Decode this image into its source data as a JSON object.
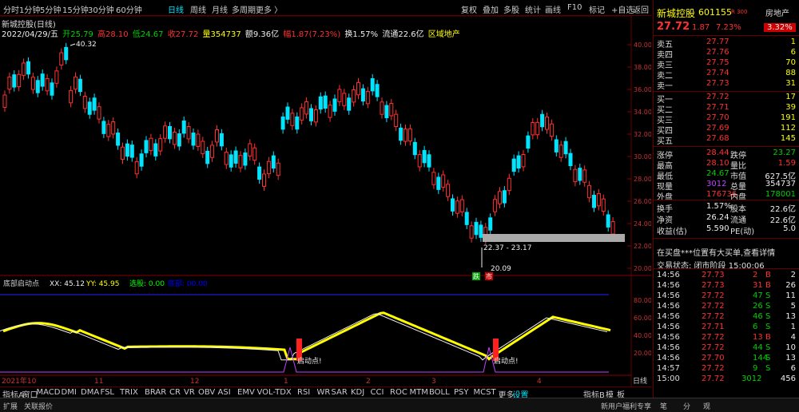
{
  "toolbar": {
    "periods": [
      "分时",
      "1分钟",
      "5分钟",
      "15分钟",
      "30分钟",
      "60分钟",
      "日线",
      "周线",
      "月线",
      "多周期",
      "更多 〉"
    ],
    "active": "日线",
    "actions": [
      "复权",
      "叠加",
      "多股",
      "统计",
      "画线",
      "F10",
      "标记",
      "+自选",
      "返回"
    ]
  },
  "info": {
    "title": "新城控股(日线)",
    "date": "2022/04/29/五",
    "open": "开25.79",
    "high": "高28.10",
    "low": "低24.67",
    "close": "收27.72",
    "volume": "量354737",
    "amount": "额9.36亿",
    "change": "幅1.87(7.23%)",
    "turnover": "换1.57%",
    "circulation": "流通22.6亿",
    "sector": "区域地产"
  },
  "price_axis": [
    "40.00",
    "38.00",
    "36.00",
    "34.00",
    "32.00",
    "30.00",
    "28.00",
    "26.00",
    "24.00",
    "22.00",
    "20.00"
  ],
  "annotations": {
    "high": "40.32",
    "low": "20.09",
    "band": "22.37 - 23.17",
    "tag1": "跌",
    "tag2": "市"
  },
  "indicator": {
    "name": "底部启动点",
    "xx": "XX: 45.12",
    "yy": "YY: 45.95",
    "sel": "选股: 0.00",
    "extra": "底部: 00.00",
    "axis": [
      "80.00",
      "60.00",
      "40.00",
      "20.00"
    ],
    "signal_label": "启动点!"
  },
  "dates": [
    "2021年10",
    "11",
    "12",
    "1",
    "2",
    "3",
    "4",
    "日线"
  ],
  "right": {
    "name": "新城控股",
    "code": "601155",
    "flag": "R 300",
    "sector": "房地产",
    "price": "27.72",
    "change": "1.87",
    "pct": "7.23%",
    "sector_pct": "3.32%",
    "sell": [
      [
        "卖五",
        "27.77",
        "1"
      ],
      [
        "卖四",
        "27.76",
        "6"
      ],
      [
        "卖三",
        "27.75",
        "70"
      ],
      [
        "卖二",
        "27.74",
        "88"
      ],
      [
        "卖一",
        "27.73",
        "31"
      ]
    ],
    "buy": [
      [
        "买一",
        "27.72",
        "17"
      ],
      [
        "买二",
        "27.71",
        "39"
      ],
      [
        "买三",
        "27.70",
        "191"
      ],
      [
        "买四",
        "27.69",
        "112"
      ],
      [
        "买五",
        "27.68",
        "145"
      ]
    ],
    "stats": [
      [
        "涨停",
        "28.44",
        "跌停",
        "23.27"
      ],
      [
        "最高",
        "28.10",
        "量比",
        "1.59"
      ],
      [
        "最低",
        "24.67",
        "市值",
        "627.5亿"
      ],
      [
        "现量",
        "3012",
        "总量",
        "354737"
      ],
      [
        "外盘",
        "176736",
        "内盘",
        "178001"
      ]
    ],
    "stats2": [
      [
        "换手",
        "1.57%",
        "股本",
        "22.6亿"
      ],
      [
        "净资",
        "26.24",
        "流通",
        "22.6亿"
      ],
      [
        "收益(估)",
        "5.590",
        "PE(动)",
        "5.0"
      ]
    ],
    "notice": "在买盘***位置有大买单,查看详情",
    "trade_status": "交易状态: 闭市阶段 15:00:06",
    "ticks": [
      [
        "14:56",
        "27.73",
        "2",
        "B",
        "2"
      ],
      [
        "14:56",
        "27.73",
        "31",
        "B",
        "26"
      ],
      [
        "14:56",
        "27.72",
        "47",
        "S",
        "11"
      ],
      [
        "14:56",
        "27.72",
        "26",
        "S",
        "5"
      ],
      [
        "14:56",
        "27.72",
        "46",
        "S",
        "13"
      ],
      [
        "14:56",
        "27.71",
        "6",
        "S",
        "1"
      ],
      [
        "14:56",
        "27.72",
        "13",
        "B",
        "4"
      ],
      [
        "14:56",
        "27.72",
        "44",
        "S",
        "10"
      ],
      [
        "14:56",
        "27.70",
        "144",
        "S",
        "13"
      ],
      [
        "14:57",
        "27.72",
        "9",
        "S",
        "6"
      ],
      [
        "15:00",
        "27.72",
        "3012",
        "",
        "456"
      ]
    ]
  },
  "bottom_tabs": [
    "指标A",
    "窗口",
    "MACD",
    "DMI",
    "DMA",
    "FSL",
    "TRIX",
    "BRAR",
    "CR",
    "VR",
    "OBV",
    "ASI",
    "EMV",
    "VOL-TDX",
    "RSI",
    "WR",
    "SAR",
    "KDJ",
    "CCI",
    "ROC",
    "MTM",
    "BOLL",
    "PSY",
    "MCST",
    "更多",
    "设置"
  ],
  "bottom_right": [
    "指标B",
    "模",
    "板"
  ],
  "status": [
    "扩展",
    "关联报价",
    "新用户福利专享",
    "笔",
    "分",
    "观"
  ]
}
